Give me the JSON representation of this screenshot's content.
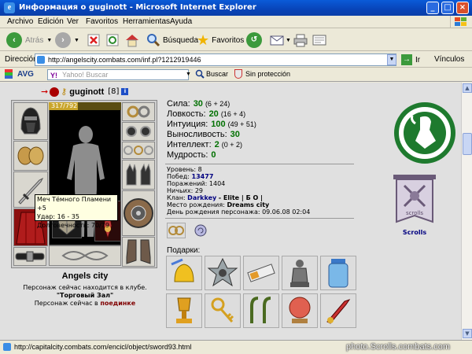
{
  "window": {
    "title": "Информация о guginott - Microsoft Internet Explorer",
    "minimize": "_",
    "maximize": "□",
    "close": "×"
  },
  "menu": [
    "Archivo",
    "Edición",
    "Ver",
    "Favoritos",
    "Herramientas",
    "Ayuda"
  ],
  "toolbar": {
    "back_label": "Atrás",
    "search_label": "Búsqueda",
    "favorites_label": "Favoritos"
  },
  "address": {
    "label": "Dirección",
    "url": "http://angelscity.combats.com/inf.pl?1212919446",
    "go_label": "Ir",
    "links_label": "Vínculos"
  },
  "avgbar": {
    "brand": "AVG",
    "search_placeholder": "Yahoo! Buscar",
    "search_button": "Buscar",
    "protection_label": "Sin protección"
  },
  "profile": {
    "name": "guginott",
    "level_badge": "[8]",
    "hp_text": "317/792",
    "hp_fraction": 0.4,
    "tooltip": {
      "line1": "Меч Тёмного Пламени +5",
      "line2": "Удар: 16 - 35",
      "line3": "Долговечность: 70/79"
    },
    "city": "Angels city",
    "location_line1": "Персонаж сейчас находится в клубе.",
    "location_room": "\"Торговый Зал\"",
    "fight_prefix": "Персонаж сейчас в",
    "fight_link": "поединке"
  },
  "stats": [
    {
      "label": "Сила:",
      "value": "30",
      "bonus": "(6 + 24)"
    },
    {
      "label": "Ловкость:",
      "value": "20",
      "bonus": "(16 + 4)"
    },
    {
      "label": "Интуиция:",
      "value": "100",
      "bonus": "(49 + 51)"
    },
    {
      "label": "Выносливость:",
      "value": "30",
      "bonus": ""
    },
    {
      "label": "Интеллект:",
      "value": "2",
      "bonus": "(0 + 2)"
    },
    {
      "label": "Мудрость:",
      "value": "0",
      "bonus": ""
    }
  ],
  "info": {
    "level": "Уровень: 8",
    "wins_label": "Побед:",
    "wins_value": "13477",
    "losses": "Поражений: 1404",
    "draws": "Ничьих: 29",
    "clan_label": "Клан:",
    "clan_name": "Darkkey",
    "clan_tail": "- Elite | Б О |",
    "birthplace_label": "Место рождения:",
    "birthplace_value": "Dreams city",
    "birthday": "День рождения персонажа: 09.06.08 02:04"
  },
  "gifts_label": "Подарки:",
  "right_panel": {
    "scroll_text": "scrolls",
    "scrolls_label": "Scrolls"
  },
  "status": {
    "url": "http://capitalcity.combats.com/encicl/object/sword93.html",
    "watermark": "photo.Scrolls.combats.com"
  },
  "colors": {
    "stat_value": "#007000",
    "link_blue": "#000080",
    "fight_red": "#800000",
    "guild_green": "#1e7a2e"
  },
  "icons": {
    "window": "ie-icon",
    "back": "back-arrow-icon",
    "forward": "forward-arrow-icon",
    "stop": "stop-icon",
    "refresh": "refresh-icon",
    "home": "home-icon",
    "search": "search-magnifier-icon",
    "favorites": "star-icon",
    "history": "history-icon",
    "mail": "mail-icon",
    "print": "printer-icon",
    "edit": "edit-icon"
  }
}
